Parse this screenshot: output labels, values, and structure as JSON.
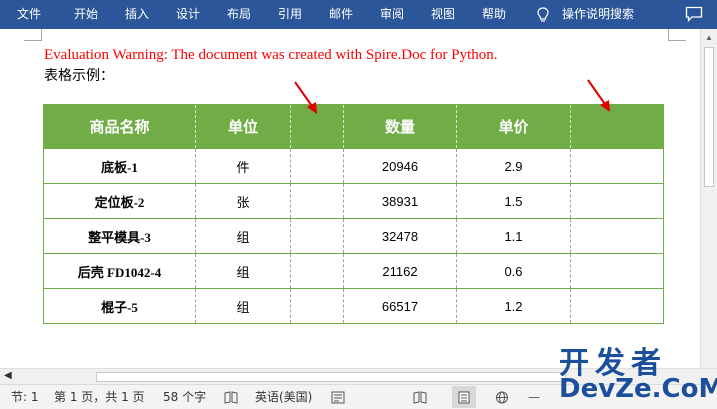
{
  "ribbon": {
    "tabs": [
      "文件",
      "开始",
      "插入",
      "设计",
      "布局",
      "引用",
      "邮件",
      "审阅",
      "视图",
      "帮助"
    ],
    "tell_me": "操作说明搜索"
  },
  "document": {
    "warning": "Evaluation Warning: The document was created with Spire.Doc for Python.",
    "caption": "表格示例："
  },
  "table": {
    "headers": [
      "商品名称",
      "单位",
      "",
      "数量",
      "单价",
      ""
    ],
    "rows": [
      [
        "底板-1",
        "件",
        "",
        "20946",
        "2.9",
        ""
      ],
      [
        "定位板-2",
        "张",
        "",
        "38931",
        "1.5",
        ""
      ],
      [
        "整平模具-3",
        "组",
        "",
        "32478",
        "1.1",
        ""
      ],
      [
        "后壳 FD1042-4",
        "组",
        "",
        "21162",
        "0.6",
        ""
      ],
      [
        "棍子-5",
        "组",
        "",
        "66517",
        "1.2",
        ""
      ]
    ]
  },
  "status": {
    "section": "节: 1",
    "page": "第 1 页，共 1 页",
    "words": "58 个字",
    "language": "英语(美国)"
  },
  "watermark": {
    "line1": "开发者",
    "line2": "DevZe.CoM"
  },
  "colors": {
    "ribbon": "#2b579a",
    "header_fill": "#70ad47",
    "warning_text": "#ff0000",
    "arrow": "#e00000"
  }
}
